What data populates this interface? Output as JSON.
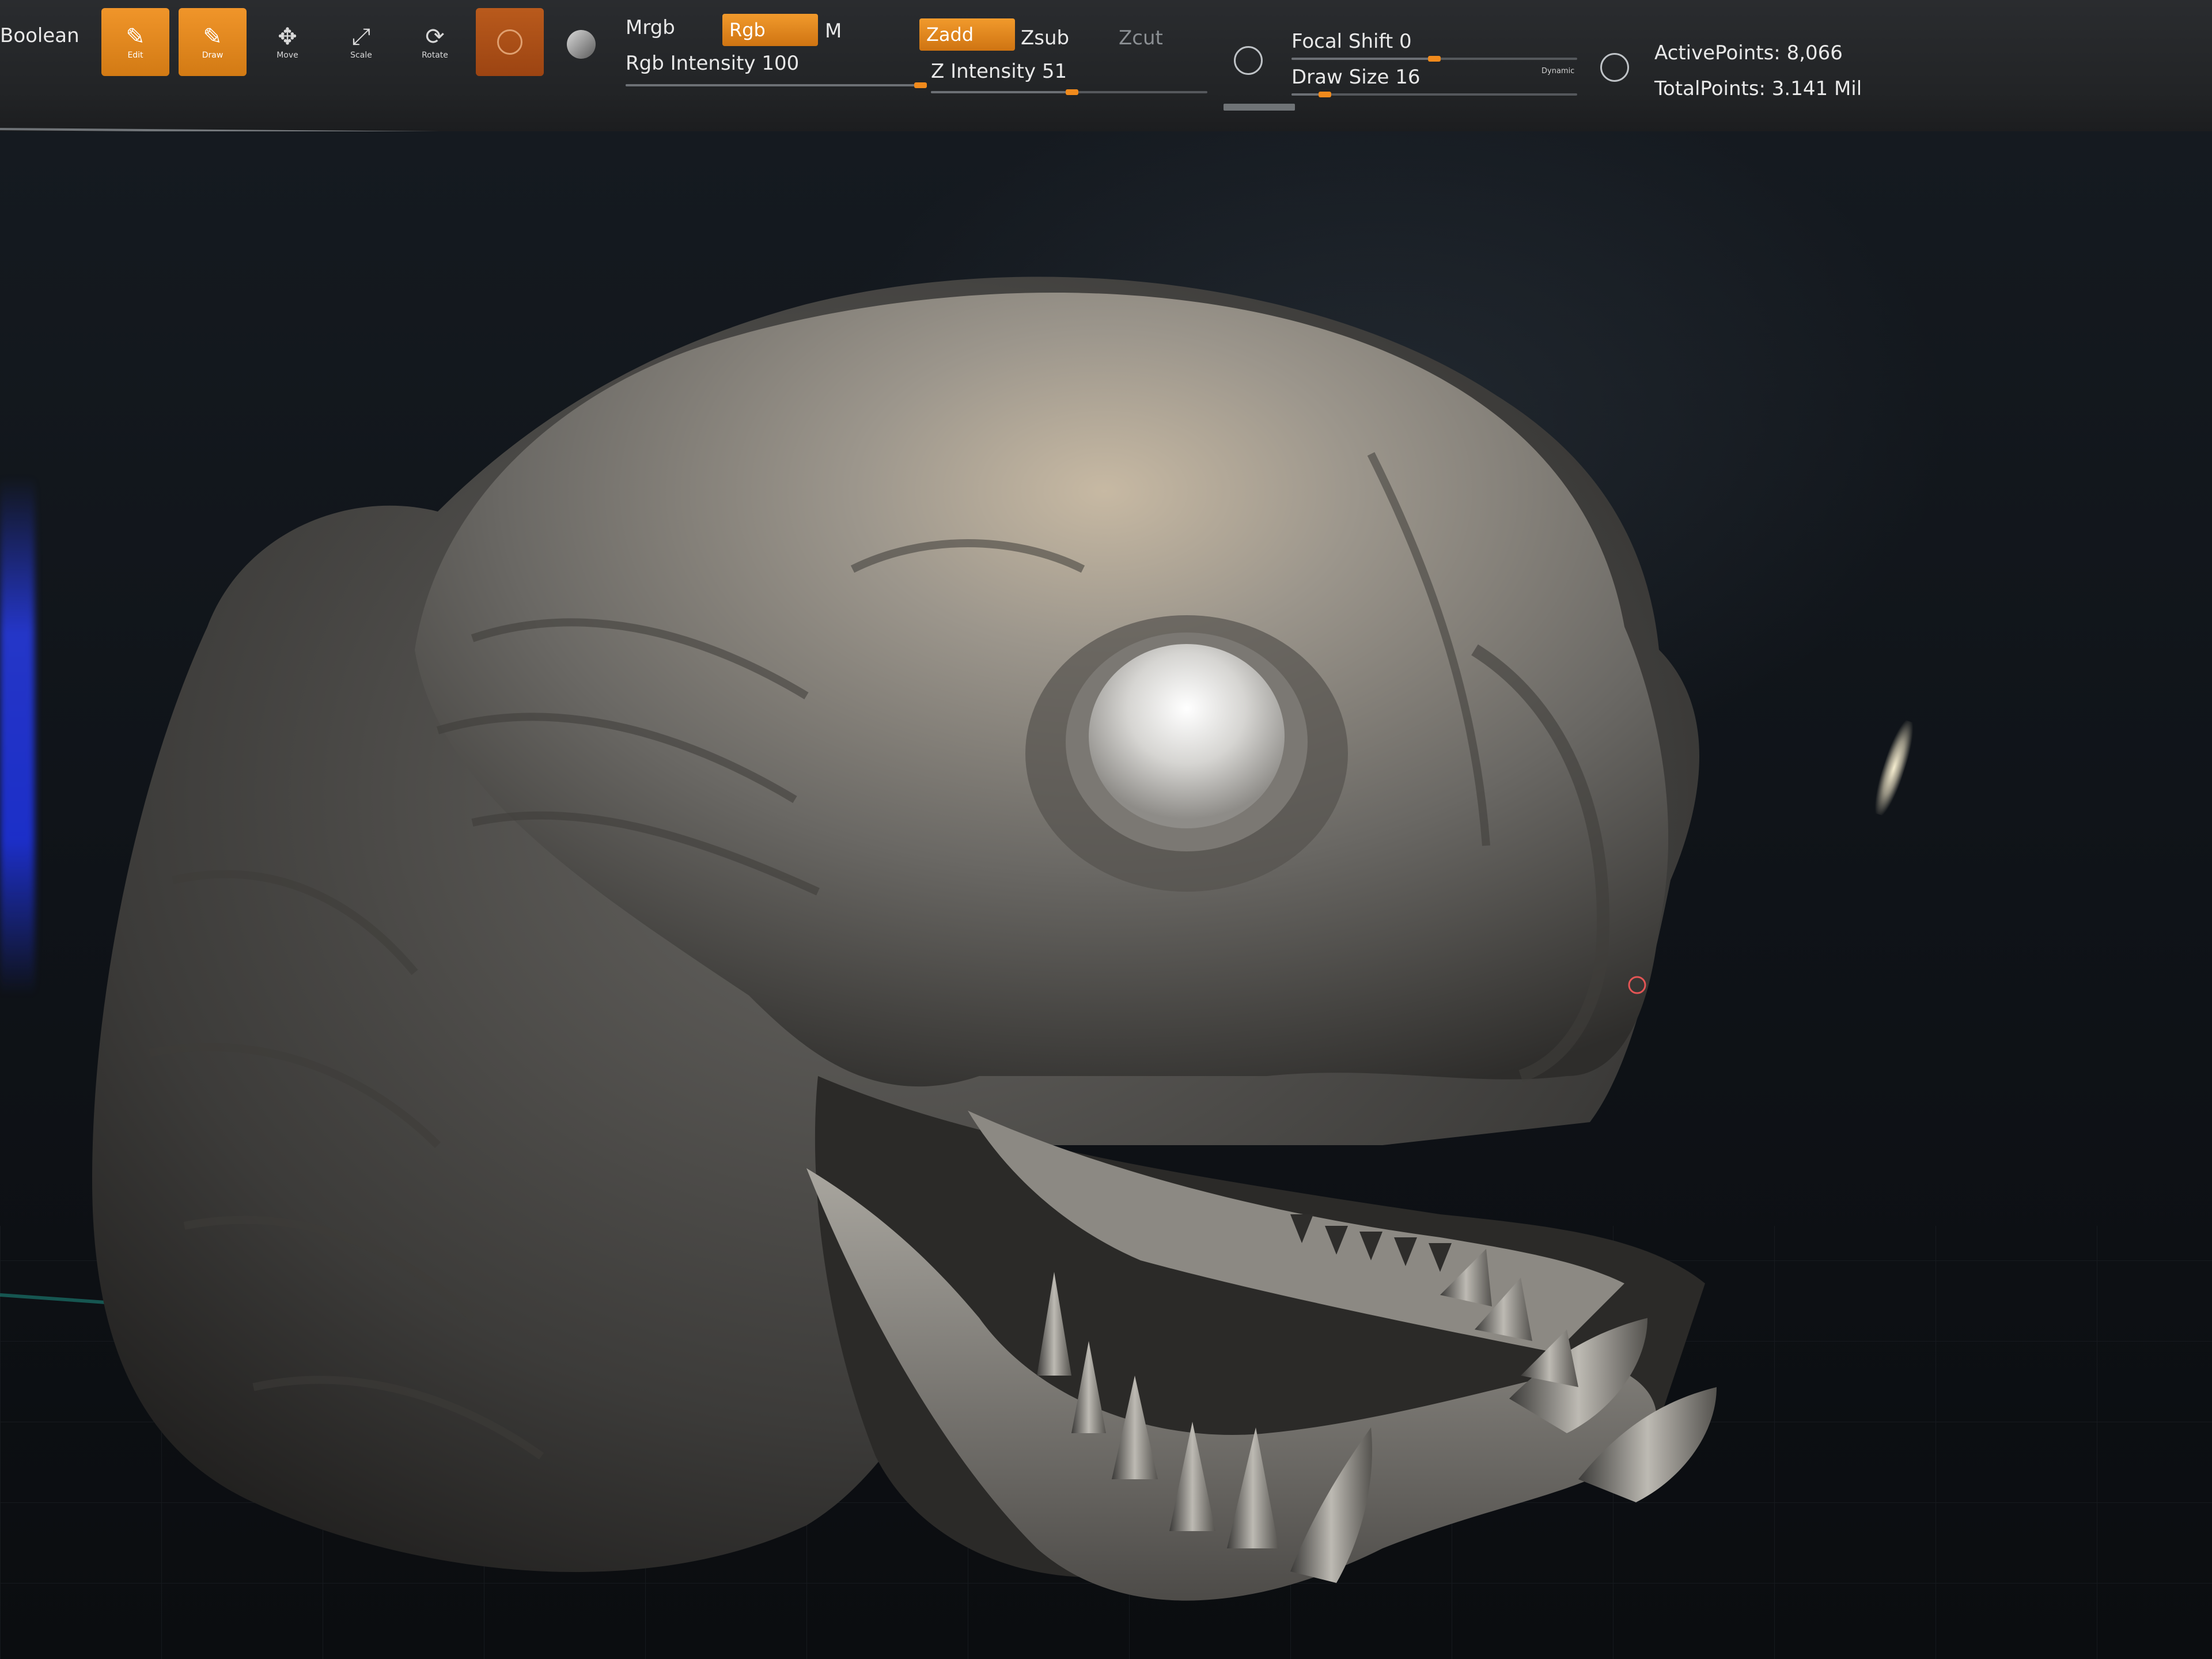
{
  "toolbar": {
    "boolean_label": "Boolean",
    "tools": [
      {
        "id": "edit",
        "glyph": "✎",
        "caption": "Edit"
      },
      {
        "id": "draw",
        "glyph": "✎",
        "caption": "Draw"
      },
      {
        "id": "move",
        "glyph": "✥",
        "caption": "Move"
      },
      {
        "id": "scale",
        "glyph": "⤢",
        "caption": "Scale"
      },
      {
        "id": "rotate",
        "glyph": "⟳",
        "caption": "Rotate"
      }
    ],
    "mrgb_label": "Mrgb",
    "rgb_label": "Rgb",
    "m_label": "M",
    "rgb_intensity_label": "Rgb Intensity 100",
    "rgb_intensity_value": 100,
    "zadd_label": "Zadd",
    "zsub_label": "Zsub",
    "zcut_label": "Zcut",
    "z_intensity_label": "Z Intensity 51",
    "z_intensity_value": 51,
    "focal_shift_label": "Focal Shift 0",
    "focal_shift_value": 0,
    "draw_size_label": "Draw Size 16",
    "draw_size_value": 16,
    "dynamic_label": "Dynamic",
    "active_points_label": "ActivePoints: 8,066",
    "total_points_label": "TotalPoints: 3.141 Mil"
  },
  "colors": {
    "accent_orange": "#f0952a",
    "shelf_bg": "#242628",
    "viewport_bg": "#0f1318",
    "clay": "#8b8985"
  },
  "icons": {
    "brush_sphere": "sphere-brush-icon",
    "material": "material-sphere-icon",
    "lightbox": "lightbox-icon",
    "draw_size_dynamic": "dynamic-icon"
  }
}
